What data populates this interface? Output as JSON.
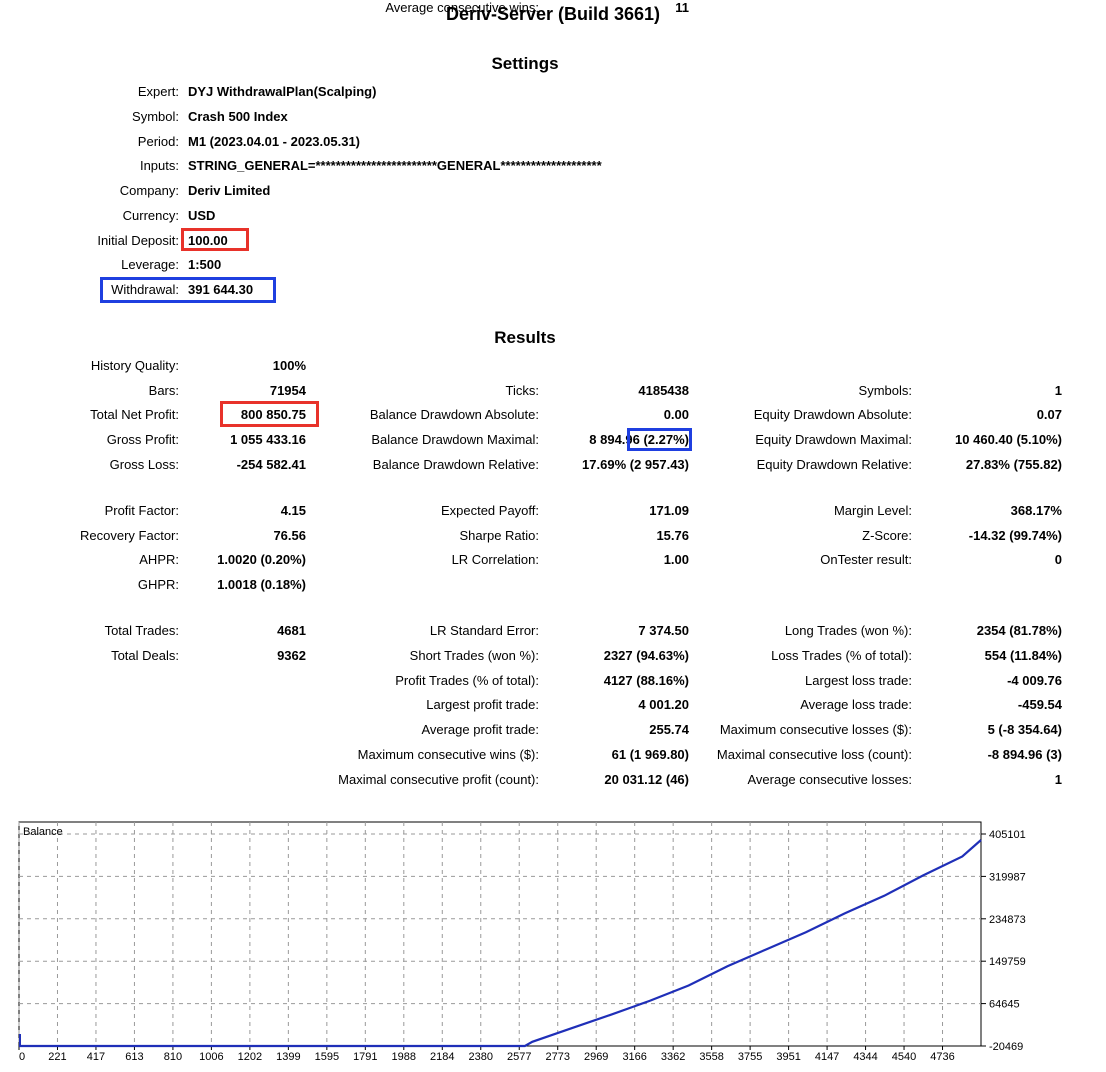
{
  "report": {
    "title": "Deriv-Server (Build 3661)"
  },
  "settings": {
    "heading": "Settings",
    "rows": [
      {
        "label": "Expert:",
        "value": "DYJ WithdrawalPlan(Scalping)"
      },
      {
        "label": "Symbol:",
        "value": "Crash 500 Index"
      },
      {
        "label": "Period:",
        "value": "M1 (2023.04.01 - 2023.05.31)"
      },
      {
        "label": "Inputs:",
        "value": "STRING_GENERAL=************************GENERAL********************"
      },
      {
        "label": "Company:",
        "value": "Deriv Limited"
      },
      {
        "label": "Currency:",
        "value": "USD"
      },
      {
        "label": "Initial Deposit:",
        "value": "100.00"
      },
      {
        "label": "Leverage:",
        "value": "1:500"
      },
      {
        "label": "Withdrawal:",
        "value": "391 644.30"
      }
    ]
  },
  "results": {
    "heading": "Results",
    "col1": [
      {
        "label": "History Quality:",
        "value": "100%"
      },
      {
        "label": "Bars:",
        "value": "71954"
      },
      {
        "label": "Total Net Profit:",
        "value": "800 850.75"
      },
      {
        "label": "Gross Profit:",
        "value": "1 055 433.16"
      },
      {
        "label": "Gross Loss:",
        "value": "-254 582.41"
      },
      {
        "label": "Profit Factor:",
        "value": "4.15"
      },
      {
        "label": "Recovery Factor:",
        "value": "76.56"
      },
      {
        "label": "AHPR:",
        "value": "1.0020 (0.20%)"
      },
      {
        "label": "GHPR:",
        "value": "1.0018 (0.18%)"
      },
      {
        "label": "Total Trades:",
        "value": "4681"
      },
      {
        "label": "Total Deals:",
        "value": "9362"
      }
    ],
    "col2": [
      {
        "label": "Ticks:",
        "value": "4185438"
      },
      {
        "label": "Balance Drawdown Absolute:",
        "value": "0.00"
      },
      {
        "label": "Balance Drawdown Maximal:",
        "value": "8 894.96 (2.27%)"
      },
      {
        "label": "Balance Drawdown Relative:",
        "value": "17.69% (2 957.43)"
      },
      {
        "label": "Expected Payoff:",
        "value": "171.09"
      },
      {
        "label": "Sharpe Ratio:",
        "value": "15.76"
      },
      {
        "label": "LR Correlation:",
        "value": "1.00"
      },
      {
        "label": "LR Standard Error:",
        "value": "7 374.50"
      },
      {
        "label": "Short Trades (won %):",
        "value": "2327 (94.63%)"
      },
      {
        "label": "Profit Trades (% of total):",
        "value": "4127 (88.16%)"
      },
      {
        "label": "Largest profit trade:",
        "value": "4 001.20"
      },
      {
        "label": "Average profit trade:",
        "value": "255.74"
      },
      {
        "label": "Maximum consecutive wins ($):",
        "value": "61 (1 969.80)"
      },
      {
        "label": "Maximal consecutive profit (count):",
        "value": "20 031.12 (46)"
      },
      {
        "label": "Average consecutive wins:",
        "value": "11"
      }
    ],
    "col3": [
      {
        "label": "Symbols:",
        "value": "1"
      },
      {
        "label": "Equity Drawdown Absolute:",
        "value": "0.07"
      },
      {
        "label": "Equity Drawdown Maximal:",
        "value": "10 460.40 (5.10%)"
      },
      {
        "label": "Equity Drawdown Relative:",
        "value": "27.83% (755.82)"
      },
      {
        "label": "Margin Level:",
        "value": "368.17%"
      },
      {
        "label": "Z-Score:",
        "value": "-14.32 (99.74%)"
      },
      {
        "label": "OnTester result:",
        "value": "0"
      },
      {
        "label": "Long Trades (won %):",
        "value": "2354 (81.78%)"
      },
      {
        "label": "Loss Trades (% of total):",
        "value": "554 (11.84%)"
      },
      {
        "label": "Largest loss trade:",
        "value": "-4 009.76"
      },
      {
        "label": "Average loss trade:",
        "value": "-459.54"
      },
      {
        "label": "Maximum consecutive losses ($):",
        "value": "5 (-8 354.64)"
      },
      {
        "label": "Maximal consecutive loss (count):",
        "value": "-8 894.96 (3)"
      },
      {
        "label": "Average consecutive losses:",
        "value": "1"
      }
    ]
  },
  "highlights": {
    "red": "#e8322a",
    "blue": "#1f3fe0",
    "line": "#1f2fb8"
  },
  "chart_data": {
    "type": "line",
    "title": "Balance",
    "x_ticks": [
      "0",
      "221",
      "417",
      "613",
      "810",
      "1006",
      "1202",
      "1399",
      "1595",
      "1791",
      "1988",
      "2184",
      "2380",
      "2577",
      "2773",
      "2969",
      "3166",
      "3362",
      "3558",
      "3755",
      "3951",
      "4147",
      "4344",
      "4540",
      "4736"
    ],
    "y_ticks": [
      "405101",
      "319987",
      "234873",
      "149759",
      "64645",
      "-20469"
    ],
    "ylim": [
      -20469,
      405101
    ],
    "xlim": [
      0,
      4830
    ],
    "grid": true,
    "series": [
      {
        "x": [
          0,
          2540,
          2577,
          2773,
          2969,
          3166,
          3362,
          3558,
          3755,
          3951,
          4147,
          4344,
          4540,
          4736,
          4830
        ],
        "y": [
          -20469,
          -20469,
          -12000,
          15000,
          42000,
          70000,
          101000,
          140000,
          174000,
          208000,
          246000,
          281000,
          322000,
          360000,
          393000
        ]
      }
    ]
  }
}
